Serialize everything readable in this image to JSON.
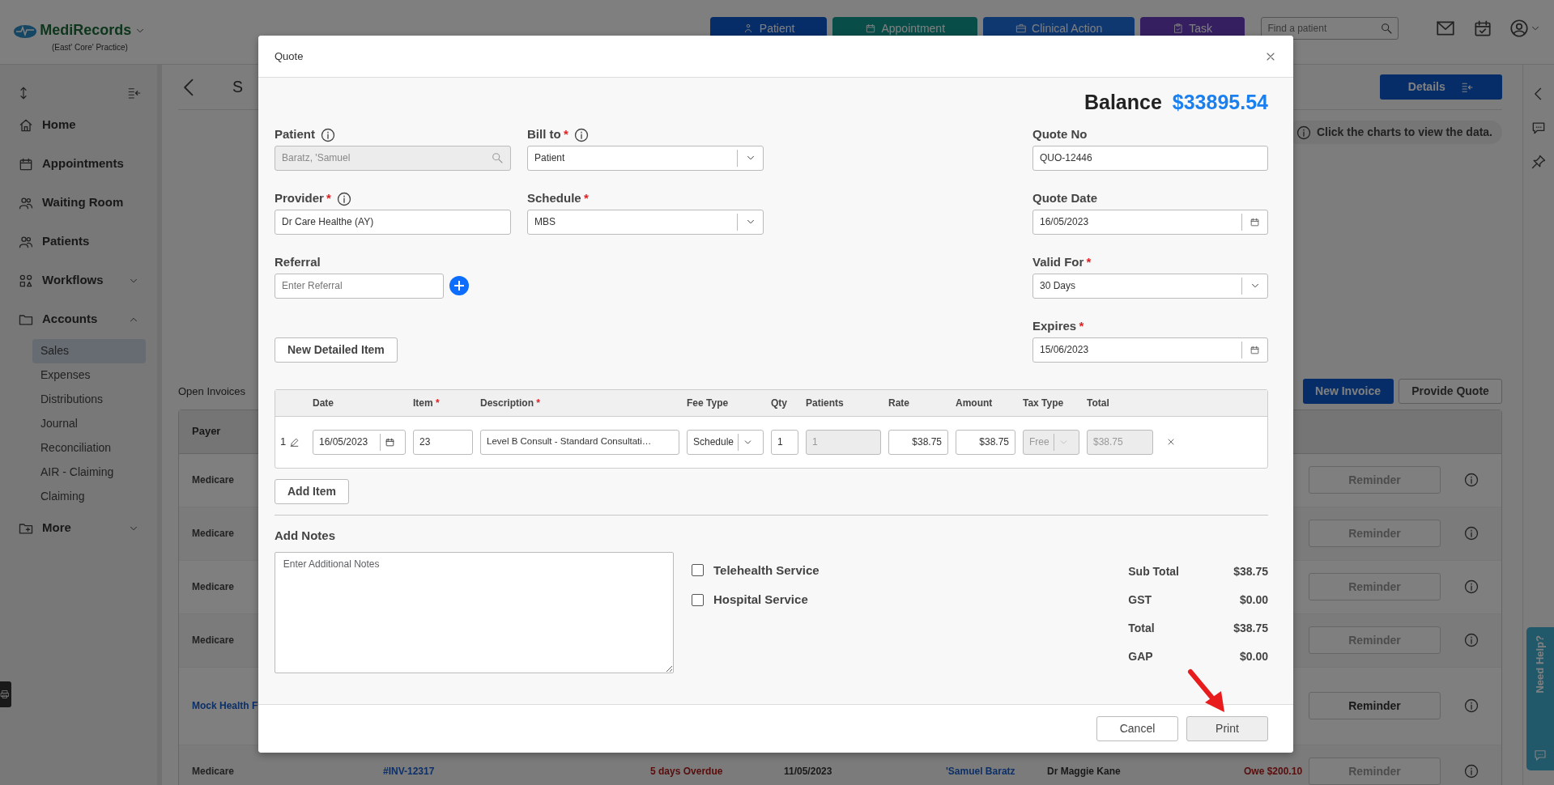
{
  "app": {
    "logo": "MediRecords",
    "practice": "(East' Core' Practice)"
  },
  "header": {
    "buttons": [
      {
        "label": "Patient"
      },
      {
        "label": "Appointment"
      },
      {
        "label": "Clinical Action"
      },
      {
        "label": "Task"
      }
    ],
    "search": {
      "placeholder": "Find a patient"
    }
  },
  "sidebar": {
    "items": [
      {
        "label": "Home"
      },
      {
        "label": "Appointments"
      },
      {
        "label": "Waiting Room"
      },
      {
        "label": "Patients"
      },
      {
        "label": "Workflows",
        "expanded": false
      },
      {
        "label": "Accounts",
        "expanded": true,
        "children": [
          {
            "label": "Sales",
            "selected": true
          },
          {
            "label": "Expenses",
            "selected": false
          },
          {
            "label": "Distributions",
            "selected": false
          },
          {
            "label": "Journal",
            "selected": false
          },
          {
            "label": "Reconciliation",
            "selected": false
          },
          {
            "label": "AIR - Claiming",
            "selected": false
          },
          {
            "label": "Claiming",
            "selected": false
          }
        ]
      },
      {
        "label": "More",
        "expanded": false
      }
    ]
  },
  "help": "Need Help?",
  "page": {
    "title": "S",
    "details_button": "Details",
    "hint": "Click the charts to view the data.",
    "section_title": "Open Invoices",
    "new_invoice": "New Invoice",
    "provide_quote": "Provide Quote",
    "table": {
      "columns": [
        "Payer"
      ],
      "rows": [
        {
          "payer": "Medicare",
          "link": false,
          "reminder": "Reminder",
          "disabled": true
        },
        {
          "payer": "Medicare",
          "link": false,
          "reminder": "Reminder",
          "disabled": true
        },
        {
          "payer": "Medicare",
          "link": false,
          "reminder": "Reminder",
          "disabled": true
        },
        {
          "payer": "Medicare",
          "link": false,
          "reminder": "Reminder",
          "disabled": true
        },
        {
          "payer": "Mock Health F",
          "link": true,
          "reminder": "Reminder",
          "disabled": false
        },
        {
          "payer": "Medicare",
          "link": false,
          "invoice": "#INV-12317",
          "status": "5 days Overdue",
          "date": "11/05/2023",
          "patient": "'Samuel Baratz",
          "provider": "Dr Maggie Kane",
          "balance": "Owe $200.10",
          "reminder": "Reminder",
          "disabled": true
        }
      ]
    }
  },
  "quote_modal": {
    "title": "Quote",
    "balance_label": "Balance",
    "balance": "$33895.54",
    "patient": {
      "label": "Patient",
      "value": "Baratz, 'Samuel",
      "disabled": true
    },
    "bill_to": {
      "label": "Bill to",
      "required_mark": "*",
      "value": "Patient"
    },
    "provider": {
      "label": "Provider",
      "required_mark": "*",
      "value": "Dr Care Healthe (AY)"
    },
    "schedule": {
      "label": "Schedule",
      "required_mark": "*",
      "value": "MBS"
    },
    "referral": {
      "label": "Referral",
      "placeholder": "Enter Referral"
    },
    "quote_no": {
      "label": "Quote No",
      "value": "QUO-12446"
    },
    "quote_date": {
      "label": "Quote Date",
      "value": "16/05/2023"
    },
    "valid_for": {
      "label": "Valid For",
      "required_mark": "*",
      "value": "30 Days"
    },
    "expires": {
      "label": "Expires",
      "required_mark": "*",
      "value": "15/06/2023"
    },
    "new_detailed_item": "New Detailed Item",
    "items_table": {
      "columns": [
        {
          "label": "Date"
        },
        {
          "label": "Item",
          "required_mark": "*"
        },
        {
          "label": "Description",
          "required_mark": "*"
        },
        {
          "label": "Fee Type"
        },
        {
          "label": "Qty"
        },
        {
          "label": "Patients"
        },
        {
          "label": "Rate"
        },
        {
          "label": "Amount"
        },
        {
          "label": "Tax Type"
        },
        {
          "label": "Total"
        }
      ],
      "rows": [
        {
          "number": "1",
          "date": "16/05/2023",
          "item": "23",
          "description": "Level B Consult - Standard Consultati…",
          "fee_type": "Schedule",
          "qty": "1",
          "patients": "1",
          "rate": "$38.75",
          "amount": "$38.75",
          "tax_type": "Free",
          "total": "$38.75"
        }
      ]
    },
    "add_item": "Add Item",
    "notes": {
      "label": "Add Notes",
      "placeholder": "Enter Additional Notes"
    },
    "services": [
      {
        "label": "Telehealth Service",
        "checked": false
      },
      {
        "label": "Hospital Service",
        "checked": false
      }
    ],
    "totals": [
      {
        "label": "Sub Total",
        "value": "$38.75"
      },
      {
        "label": "GST",
        "value": "$0.00"
      },
      {
        "label": "Total",
        "value": "$38.75"
      },
      {
        "label": "GAP",
        "value": "$0.00"
      }
    ],
    "cancel": "Cancel",
    "print": "Print"
  }
}
